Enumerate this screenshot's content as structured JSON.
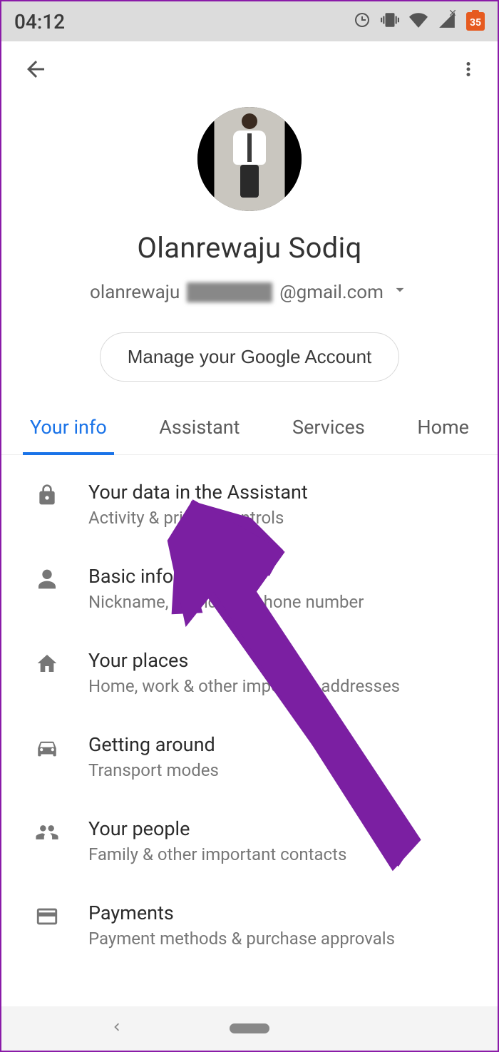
{
  "status": {
    "time": "04:12",
    "battery_text": "35"
  },
  "profile": {
    "name": "Olanrewaju Sodiq",
    "email_prefix": "olanrewaju",
    "email_suffix": "@gmail.com",
    "manage_button": "Manage your Google Account"
  },
  "tabs": [
    {
      "label": "Your info",
      "active": true
    },
    {
      "label": "Assistant",
      "active": false
    },
    {
      "label": "Services",
      "active": false
    },
    {
      "label": "Home",
      "active": false
    }
  ],
  "items": [
    {
      "icon": "lock-icon",
      "title": "Your data in the Assistant",
      "sub": "Activity & privacy controls"
    },
    {
      "icon": "person-icon",
      "title": "Basic info",
      "sub": "Nickname, birthday & phone number"
    },
    {
      "icon": "home-icon",
      "title": "Your places",
      "sub": "Home, work & other important addresses"
    },
    {
      "icon": "car-icon",
      "title": "Getting around",
      "sub": "Transport modes"
    },
    {
      "icon": "people-icon",
      "title": "Your people",
      "sub": "Family & other important contacts"
    },
    {
      "icon": "card-icon",
      "title": "Payments",
      "sub": "Payment methods & purchase approvals"
    }
  ],
  "colors": {
    "accent": "#1a73e8",
    "annotation": "#7b1fa2"
  }
}
